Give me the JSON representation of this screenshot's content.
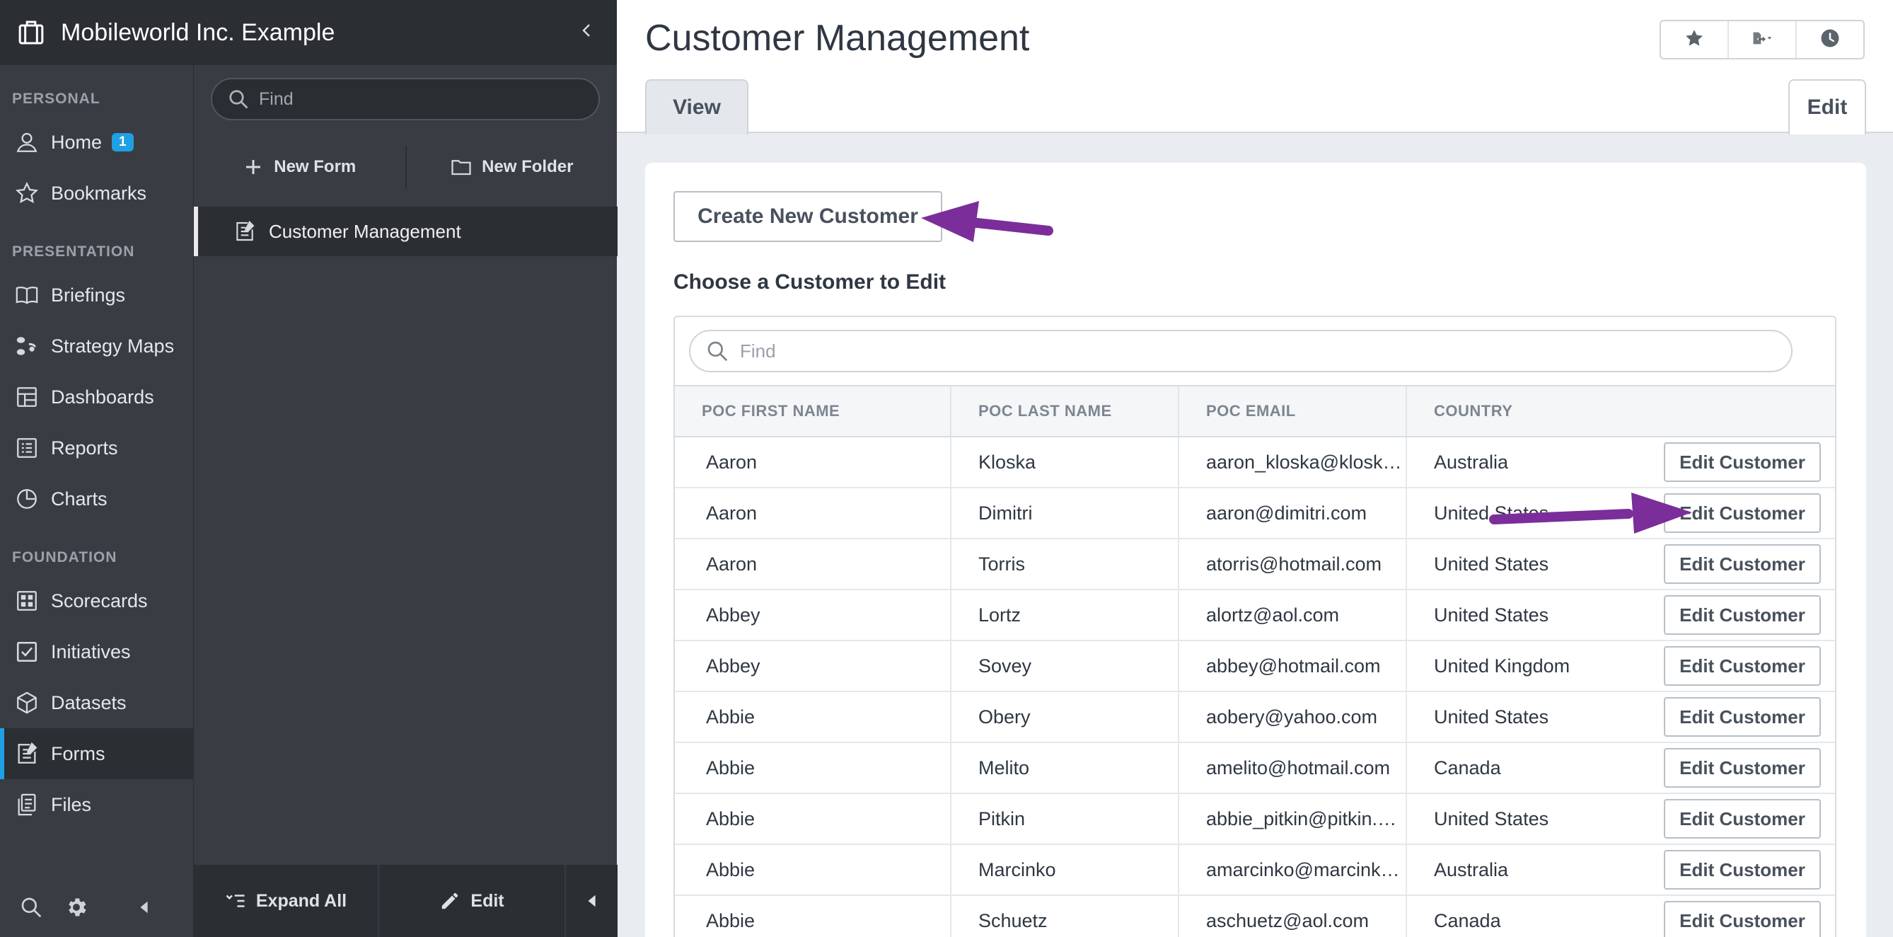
{
  "org": {
    "title": "Mobileworld Inc. Example"
  },
  "nav": {
    "sections": {
      "personal": "PERSONAL",
      "presentation": "PRESENTATION",
      "foundation": "FOUNDATION"
    },
    "items": [
      {
        "label": "Home",
        "icon": "user-icon",
        "badge": "1"
      },
      {
        "label": "Bookmarks",
        "icon": "star-icon"
      },
      {
        "label": "Briefings",
        "icon": "book-icon"
      },
      {
        "label": "Strategy Maps",
        "icon": "strategy-map-icon"
      },
      {
        "label": "Dashboards",
        "icon": "dashboard-icon"
      },
      {
        "label": "Reports",
        "icon": "report-icon"
      },
      {
        "label": "Charts",
        "icon": "pie-chart-icon"
      },
      {
        "label": "Scorecards",
        "icon": "scorecard-icon"
      },
      {
        "label": "Initiatives",
        "icon": "checkbox-icon"
      },
      {
        "label": "Datasets",
        "icon": "cube-icon"
      },
      {
        "label": "Forms",
        "icon": "form-icon",
        "active": true
      },
      {
        "label": "Files",
        "icon": "files-icon"
      }
    ]
  },
  "mid": {
    "search_placeholder": "Find",
    "new_form": "New Form",
    "new_folder": "New Folder",
    "item": "Customer Management",
    "expand_all": "Expand All",
    "edit": "Edit"
  },
  "main": {
    "title": "Customer Management",
    "tabs": {
      "view": "View",
      "edit": "Edit"
    },
    "create_button": "Create New Customer",
    "choose_heading": "Choose a Customer to Edit",
    "grid_search_placeholder": "Find",
    "columns": [
      "POC FIRST NAME",
      "POC LAST NAME",
      "POC EMAIL",
      "COUNTRY"
    ],
    "row_action": "Edit Customer",
    "rows": [
      [
        "Aaron",
        "Kloska",
        "aaron_kloska@kloska.com",
        "Australia"
      ],
      [
        "Aaron",
        "Dimitri",
        "aaron@dimitri.com",
        "United States"
      ],
      [
        "Aaron",
        "Torris",
        "atorris@hotmail.com",
        "United States"
      ],
      [
        "Abbey",
        "Lortz",
        "alortz@aol.com",
        "United States"
      ],
      [
        "Abbey",
        "Sovey",
        "abbey@hotmail.com",
        "United Kingdom"
      ],
      [
        "Abbie",
        "Obery",
        "aobery@yahoo.com",
        "United States"
      ],
      [
        "Abbie",
        "Melito",
        "amelito@hotmail.com",
        "Canada"
      ],
      [
        "Abbie",
        "Pitkin",
        "abbie_pitkin@pitkin.com",
        "United States"
      ],
      [
        "Abbie",
        "Marcinko",
        "amarcinko@marcinko.com",
        "Australia"
      ],
      [
        "Abbie",
        "Schuetz",
        "aschuetz@aol.com",
        "Canada"
      ]
    ]
  },
  "colors": {
    "accent": "#1fa0e4",
    "arrow": "#7b2d9a",
    "nav_bg": "#393d43",
    "header_bg": "#2b2e33"
  }
}
